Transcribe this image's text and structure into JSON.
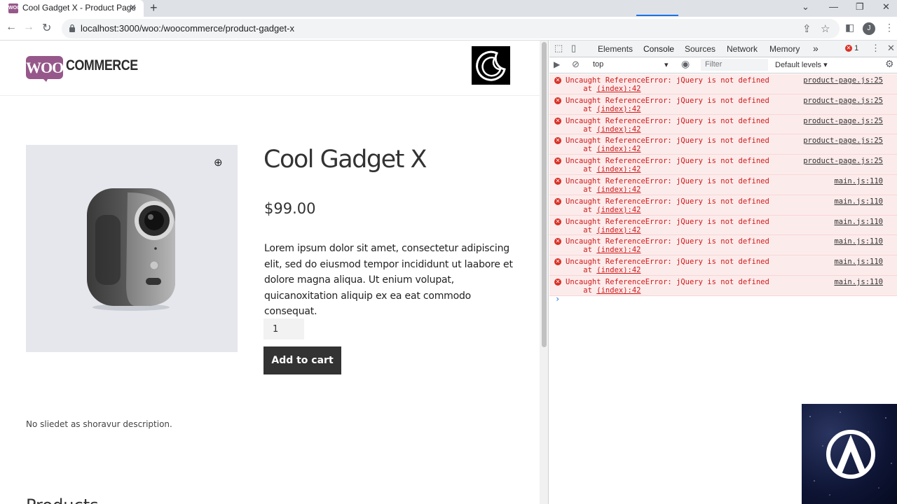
{
  "browser": {
    "tab_title": "Cool Gadget X - Product Page",
    "tab_favicon_text": "WOO",
    "new_tab": "+",
    "url": "localhost:3000/woo:/woocommerce/product-gadget-x",
    "avatar_letter": "J"
  },
  "site": {
    "logo_woo": "WOO",
    "logo_text": "COMMERCE",
    "product": {
      "title": "Cool Gadget X",
      "price": "$99.00",
      "description": "Lorem ipsum dolor sit amet, consectetur adipiscing elit, sed do eiusmod tempor incididunt ut laabore et dolore magna aliqua. Ut enium volupat, quicanoxitation aliquip ex ea eat commodo consequat.",
      "quantity": "1",
      "add_to_cart": "Add to cart",
      "short_description": "No sliedet as shoravur description.",
      "related_heading": "Products"
    }
  },
  "devtools": {
    "tabs": [
      "Elements",
      "Console",
      "Sources",
      "Network",
      "Memory"
    ],
    "active_tab": "Console",
    "more": "»",
    "error_count": "1",
    "context": "top",
    "filter_placeholder": "Filter",
    "levels": "Default levels ▾",
    "logs": [
      {
        "message": "Uncaught ReferenceError: jQuery is not defined",
        "at": "at",
        "link": "(index):42",
        "source": "product-page.js:25"
      },
      {
        "message": "Uncaught ReferenceError: jQuery is not defined",
        "at": "at",
        "link": "(index):42",
        "source": "product-page.js:25"
      },
      {
        "message": "Uncaught ReferenceError: jQuery is not defined",
        "at": "at",
        "link": "(index):42",
        "source": "product-page.js:25"
      },
      {
        "message": "Uncaught ReferenceError: jQuery is not defined",
        "at": "at",
        "link": "(index):42",
        "source": "product-page.js:25"
      },
      {
        "message": "Uncaught ReferenceError: jQuery is not defined",
        "at": "at",
        "link": "(index):42",
        "source": "product-page.js:25"
      },
      {
        "message": "Uncaught ReferenceError: jQuery is not defined",
        "at": "at",
        "link": "(index):42",
        "source": "main.js:110"
      },
      {
        "message": "Uncaught ReferenceError: jQuery is not defined",
        "at": "at",
        "link": "(index):42",
        "source": "main.js:110"
      },
      {
        "message": "Uncaught ReferenceError: jQuery is not defined",
        "at": "at",
        "link": "(index):42",
        "source": "main.js:110"
      },
      {
        "message": "Uncaught ReferenceError: jQuery is not defined",
        "at": "at",
        "link": "(index):42",
        "source": "main.js:110"
      },
      {
        "message": "Uncaught ReferenceError: jQuery is not defined",
        "at": "at",
        "link": "(index):42",
        "source": "main.js:110"
      },
      {
        "message": "Uncaught ReferenceError: jQuery is not defined",
        "at": "at",
        "link": "(index):42",
        "source": "main.js:110"
      }
    ],
    "prompt": "›"
  },
  "colors": {
    "woo_purple": "#96588a",
    "error_red": "#d93025",
    "error_bg": "#fcebeb",
    "devtools_blue": "#1a73e8"
  }
}
